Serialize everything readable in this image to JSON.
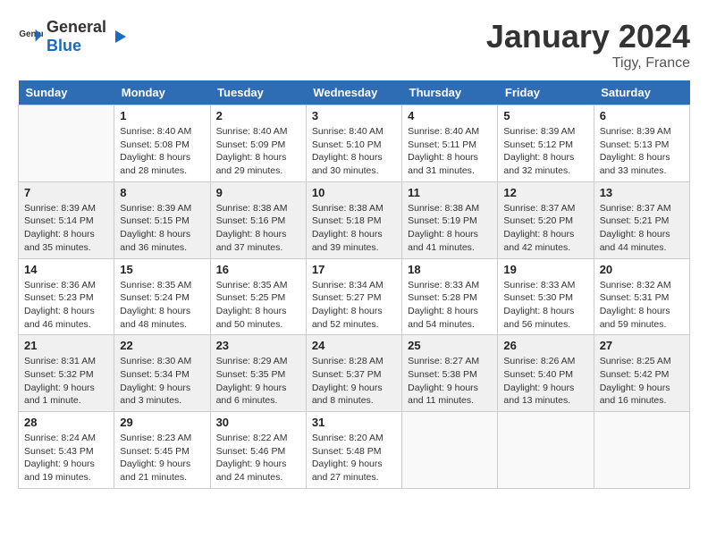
{
  "header": {
    "logo_general": "General",
    "logo_blue": "Blue",
    "month": "January 2024",
    "location": "Tigy, France"
  },
  "days_of_week": [
    "Sunday",
    "Monday",
    "Tuesday",
    "Wednesday",
    "Thursday",
    "Friday",
    "Saturday"
  ],
  "weeks": [
    [
      {
        "day": "",
        "sunrise": "",
        "sunset": "",
        "daylight": ""
      },
      {
        "day": "1",
        "sunrise": "Sunrise: 8:40 AM",
        "sunset": "Sunset: 5:08 PM",
        "daylight": "Daylight: 8 hours and 28 minutes."
      },
      {
        "day": "2",
        "sunrise": "Sunrise: 8:40 AM",
        "sunset": "Sunset: 5:09 PM",
        "daylight": "Daylight: 8 hours and 29 minutes."
      },
      {
        "day": "3",
        "sunrise": "Sunrise: 8:40 AM",
        "sunset": "Sunset: 5:10 PM",
        "daylight": "Daylight: 8 hours and 30 minutes."
      },
      {
        "day": "4",
        "sunrise": "Sunrise: 8:40 AM",
        "sunset": "Sunset: 5:11 PM",
        "daylight": "Daylight: 8 hours and 31 minutes."
      },
      {
        "day": "5",
        "sunrise": "Sunrise: 8:39 AM",
        "sunset": "Sunset: 5:12 PM",
        "daylight": "Daylight: 8 hours and 32 minutes."
      },
      {
        "day": "6",
        "sunrise": "Sunrise: 8:39 AM",
        "sunset": "Sunset: 5:13 PM",
        "daylight": "Daylight: 8 hours and 33 minutes."
      }
    ],
    [
      {
        "day": "7",
        "sunrise": "Sunrise: 8:39 AM",
        "sunset": "Sunset: 5:14 PM",
        "daylight": "Daylight: 8 hours and 35 minutes."
      },
      {
        "day": "8",
        "sunrise": "Sunrise: 8:39 AM",
        "sunset": "Sunset: 5:15 PM",
        "daylight": "Daylight: 8 hours and 36 minutes."
      },
      {
        "day": "9",
        "sunrise": "Sunrise: 8:38 AM",
        "sunset": "Sunset: 5:16 PM",
        "daylight": "Daylight: 8 hours and 37 minutes."
      },
      {
        "day": "10",
        "sunrise": "Sunrise: 8:38 AM",
        "sunset": "Sunset: 5:18 PM",
        "daylight": "Daylight: 8 hours and 39 minutes."
      },
      {
        "day": "11",
        "sunrise": "Sunrise: 8:38 AM",
        "sunset": "Sunset: 5:19 PM",
        "daylight": "Daylight: 8 hours and 41 minutes."
      },
      {
        "day": "12",
        "sunrise": "Sunrise: 8:37 AM",
        "sunset": "Sunset: 5:20 PM",
        "daylight": "Daylight: 8 hours and 42 minutes."
      },
      {
        "day": "13",
        "sunrise": "Sunrise: 8:37 AM",
        "sunset": "Sunset: 5:21 PM",
        "daylight": "Daylight: 8 hours and 44 minutes."
      }
    ],
    [
      {
        "day": "14",
        "sunrise": "Sunrise: 8:36 AM",
        "sunset": "Sunset: 5:23 PM",
        "daylight": "Daylight: 8 hours and 46 minutes."
      },
      {
        "day": "15",
        "sunrise": "Sunrise: 8:35 AM",
        "sunset": "Sunset: 5:24 PM",
        "daylight": "Daylight: 8 hours and 48 minutes."
      },
      {
        "day": "16",
        "sunrise": "Sunrise: 8:35 AM",
        "sunset": "Sunset: 5:25 PM",
        "daylight": "Daylight: 8 hours and 50 minutes."
      },
      {
        "day": "17",
        "sunrise": "Sunrise: 8:34 AM",
        "sunset": "Sunset: 5:27 PM",
        "daylight": "Daylight: 8 hours and 52 minutes."
      },
      {
        "day": "18",
        "sunrise": "Sunrise: 8:33 AM",
        "sunset": "Sunset: 5:28 PM",
        "daylight": "Daylight: 8 hours and 54 minutes."
      },
      {
        "day": "19",
        "sunrise": "Sunrise: 8:33 AM",
        "sunset": "Sunset: 5:30 PM",
        "daylight": "Daylight: 8 hours and 56 minutes."
      },
      {
        "day": "20",
        "sunrise": "Sunrise: 8:32 AM",
        "sunset": "Sunset: 5:31 PM",
        "daylight": "Daylight: 8 hours and 59 minutes."
      }
    ],
    [
      {
        "day": "21",
        "sunrise": "Sunrise: 8:31 AM",
        "sunset": "Sunset: 5:32 PM",
        "daylight": "Daylight: 9 hours and 1 minute."
      },
      {
        "day": "22",
        "sunrise": "Sunrise: 8:30 AM",
        "sunset": "Sunset: 5:34 PM",
        "daylight": "Daylight: 9 hours and 3 minutes."
      },
      {
        "day": "23",
        "sunrise": "Sunrise: 8:29 AM",
        "sunset": "Sunset: 5:35 PM",
        "daylight": "Daylight: 9 hours and 6 minutes."
      },
      {
        "day": "24",
        "sunrise": "Sunrise: 8:28 AM",
        "sunset": "Sunset: 5:37 PM",
        "daylight": "Daylight: 9 hours and 8 minutes."
      },
      {
        "day": "25",
        "sunrise": "Sunrise: 8:27 AM",
        "sunset": "Sunset: 5:38 PM",
        "daylight": "Daylight: 9 hours and 11 minutes."
      },
      {
        "day": "26",
        "sunrise": "Sunrise: 8:26 AM",
        "sunset": "Sunset: 5:40 PM",
        "daylight": "Daylight: 9 hours and 13 minutes."
      },
      {
        "day": "27",
        "sunrise": "Sunrise: 8:25 AM",
        "sunset": "Sunset: 5:42 PM",
        "daylight": "Daylight: 9 hours and 16 minutes."
      }
    ],
    [
      {
        "day": "28",
        "sunrise": "Sunrise: 8:24 AM",
        "sunset": "Sunset: 5:43 PM",
        "daylight": "Daylight: 9 hours and 19 minutes."
      },
      {
        "day": "29",
        "sunrise": "Sunrise: 8:23 AM",
        "sunset": "Sunset: 5:45 PM",
        "daylight": "Daylight: 9 hours and 21 minutes."
      },
      {
        "day": "30",
        "sunrise": "Sunrise: 8:22 AM",
        "sunset": "Sunset: 5:46 PM",
        "daylight": "Daylight: 9 hours and 24 minutes."
      },
      {
        "day": "31",
        "sunrise": "Sunrise: 8:20 AM",
        "sunset": "Sunset: 5:48 PM",
        "daylight": "Daylight: 9 hours and 27 minutes."
      },
      {
        "day": "",
        "sunrise": "",
        "sunset": "",
        "daylight": ""
      },
      {
        "day": "",
        "sunrise": "",
        "sunset": "",
        "daylight": ""
      },
      {
        "day": "",
        "sunrise": "",
        "sunset": "",
        "daylight": ""
      }
    ]
  ]
}
